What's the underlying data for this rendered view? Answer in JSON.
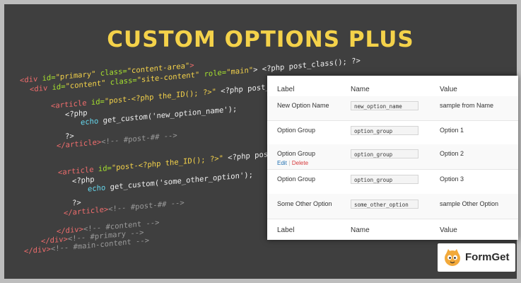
{
  "banner": {
    "title": "CUSTOM OPTIONS PLUS"
  },
  "code": {
    "line1": {
      "pre": "<div ",
      "a1": "id=",
      "v1": "\"primary\" ",
      "a2": "class=",
      "v2": "\"content-area\"",
      "post": ">"
    },
    "line2": {
      "pre": "<div ",
      "a1": "id=",
      "v1": "\"content\" ",
      "a2": "class=",
      "v2": "\"site-content\" ",
      "a3": "role=",
      "v3": "\"main\"",
      "post": "> <?php post_class(); ?>"
    },
    "line3": {
      "pre": "<article ",
      "a1": "id=",
      "v1": "\"post-<?php the_ID(); ?>\"",
      "post": " <?php post_class(); ?>"
    },
    "line4": "<?php",
    "line5": {
      "kw": "echo",
      "rest": " get_custom('new_option_name');"
    },
    "line6": "?>",
    "line7": {
      "tag": "</article>",
      "cmt": "<!-- #post-## -->"
    },
    "line8": {
      "pre": "<article ",
      "a1": "id=",
      "v1": "\"post-<?php the_ID(); ?>\"",
      "post": " <?php post_class(); ?>"
    },
    "line9": "<?php",
    "line10": {
      "kw": "echo",
      "rest": " get_custom('some_other_option');"
    },
    "line11": "?>",
    "line12": {
      "tag": "</article>",
      "cmt": "<!-- #post-## -->"
    },
    "line13": {
      "tag": "</div>",
      "cmt": "<!-- #content -->"
    },
    "line14": {
      "tag": "</div>",
      "cmt": "<!-- #primary -->"
    },
    "line15": {
      "tag": "</div>",
      "cmt": "<!-- #main-content -->"
    }
  },
  "table": {
    "header": {
      "label": "Label",
      "name": "Name",
      "value": "Value"
    },
    "rows": [
      {
        "label": "New Option Name",
        "name": "new_option_name",
        "value": "sample from Name"
      },
      {
        "label": "Option Group",
        "name": "option_group",
        "value": "Option 1"
      },
      {
        "label": "Option Group",
        "name": "option_group",
        "value": "Option 2",
        "edit": "Edit",
        "sep": "|",
        "delete": "Delete"
      },
      {
        "label": "Option Group",
        "name": "option_group",
        "value": "Option 3"
      },
      {
        "label": "Some Other Option",
        "name": "some_other_option",
        "value": "sample Other Option"
      }
    ],
    "footer": {
      "label": "Label",
      "name": "Name",
      "value": "Value"
    }
  },
  "logo": {
    "text": "FormGet"
  },
  "colors": {
    "title": "#f4d24a",
    "background": "#3f3f3f",
    "frame": "#bdbdbd",
    "link": "#2271b1",
    "delete": "#d63638"
  }
}
